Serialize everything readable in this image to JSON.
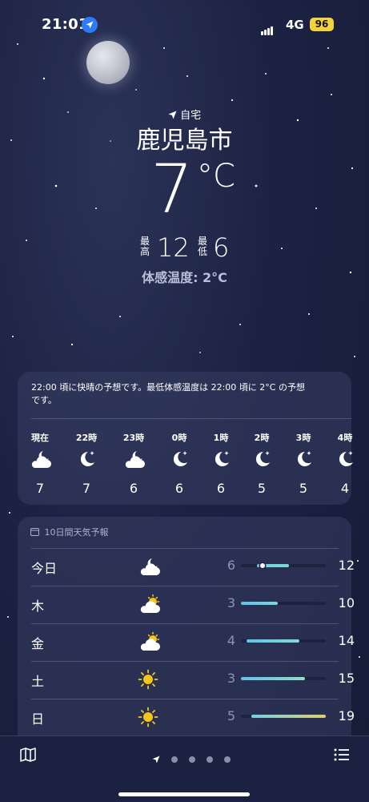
{
  "status_bar": {
    "time": "21:01",
    "network": "4G",
    "battery": "96"
  },
  "location": {
    "label": "自宅",
    "city": "鹿児島市"
  },
  "current": {
    "temperature": "7",
    "unit": "°C",
    "high_label": "最高",
    "high": "12",
    "low_label": "最低",
    "low": "6",
    "feels_like": "体感温度: 2°C"
  },
  "hourly": {
    "summary": "22:00 頃に快晴の予想です。最低体感温度は 22:00 頃に 2°C の予想です。",
    "items": [
      {
        "time": "現在",
        "icon": "partly-cloudy-night-icon",
        "temp": "7"
      },
      {
        "time": "22時",
        "icon": "clear-night-icon",
        "temp": "7"
      },
      {
        "time": "23時",
        "icon": "partly-cloudy-night-icon",
        "temp": "6"
      },
      {
        "time": "0時",
        "icon": "clear-night-icon",
        "temp": "6"
      },
      {
        "time": "1時",
        "icon": "clear-night-icon",
        "temp": "6"
      },
      {
        "time": "2時",
        "icon": "clear-night-icon",
        "temp": "5"
      },
      {
        "time": "3時",
        "icon": "clear-night-icon",
        "temp": "5"
      },
      {
        "time": "4時",
        "icon": "clear-night-icon",
        "temp": "4"
      }
    ]
  },
  "daily": {
    "title": "10日間天気予報",
    "range": [
      3,
      19
    ],
    "items": [
      {
        "day": "今日",
        "icon": "partly-cloudy-night-icon",
        "low": "6",
        "high": "12",
        "current": 7,
        "colors": [
          "#6fd3e6",
          "#7fd9d2"
        ]
      },
      {
        "day": "木",
        "icon": "partly-sunny-icon",
        "low": "3",
        "high": "10",
        "colors": [
          "#5ec3ea",
          "#78d6dc"
        ]
      },
      {
        "day": "金",
        "icon": "partly-sunny-icon",
        "low": "4",
        "high": "14",
        "colors": [
          "#5ec3ea",
          "#82dccd"
        ]
      },
      {
        "day": "土",
        "icon": "sun-icon",
        "low": "3",
        "high": "15",
        "colors": [
          "#5ec3ea",
          "#8ce0c6"
        ]
      },
      {
        "day": "日",
        "icon": "sun-icon",
        "low": "5",
        "high": "19",
        "colors": [
          "#6fd3e6",
          "#e2cd6a"
        ]
      }
    ]
  },
  "colors": {
    "accent": "#2f7bf6",
    "battery": "#f3d33b",
    "sun": "#f5c518"
  }
}
